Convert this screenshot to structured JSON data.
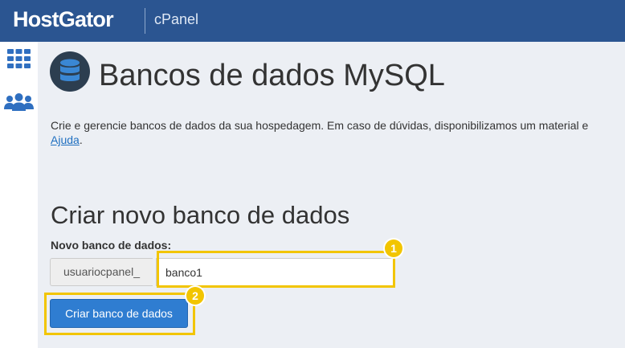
{
  "header": {
    "brand": "HostGator",
    "product": "cPanel"
  },
  "sidebar": {
    "icons": [
      "apps-grid-icon",
      "users-icon"
    ]
  },
  "page": {
    "title": "Bancos de dados MySQL",
    "description": "Crie e gerencie bancos de dados da sua hospedagem. Em caso de dúvidas, disponibilizamos um material e",
    "help_link": "Ajuda",
    "help_suffix": "."
  },
  "create_db": {
    "section_title": "Criar novo banco de dados",
    "field_label": "Novo banco de dados:",
    "prefix": "usuariocpanel_",
    "input_value": "banco1",
    "button_label": "Criar banco de dados"
  },
  "annotations": {
    "step1": "1",
    "step2": "2"
  },
  "colors": {
    "header_bg": "#2b5591",
    "accent_blue": "#2f7dd1",
    "highlight": "#f2c500",
    "page_bg": "#eceff4"
  }
}
